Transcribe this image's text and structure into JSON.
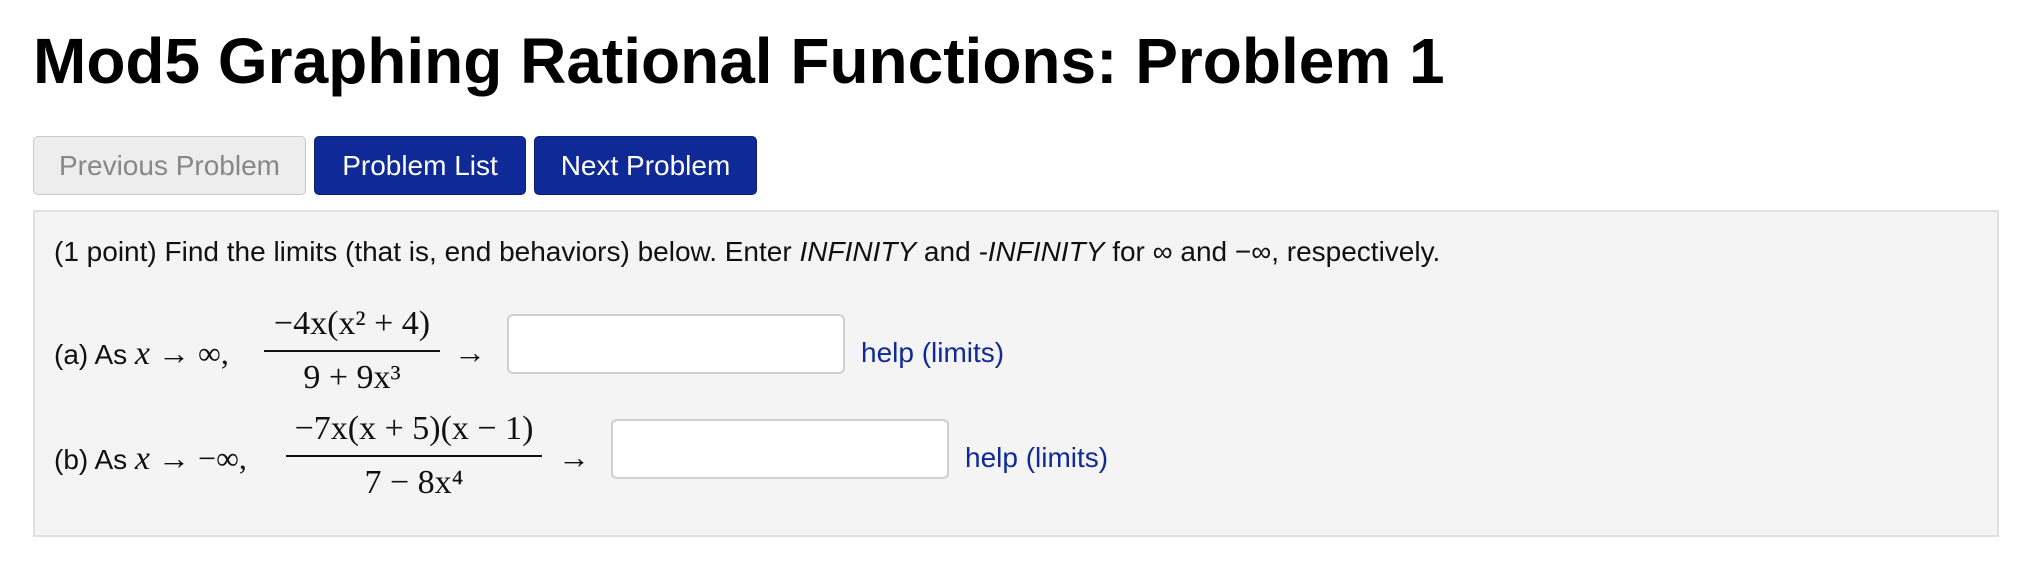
{
  "page": {
    "title": "Mod5 Graphing Rational Functions: Problem 1"
  },
  "nav": {
    "previous": "Previous Problem",
    "list": "Problem List",
    "next": "Next Problem"
  },
  "problem": {
    "points": "(1 point) Find the limits (that is, end behaviors) below. Enter ",
    "pos_inf_word": "INFINITY",
    "and_word": " and ",
    "neg_inf_word": "-INFINITY",
    "for_word": " for ∞ and −∞, respectively.",
    "parts": [
      {
        "label": "(a) As ",
        "var": "x",
        "approach": " → ∞,",
        "numerator": "−4x(x² + 4)",
        "denominator": "9 + 9x³",
        "arrow": "→",
        "answer": "",
        "help": "help (limits)"
      },
      {
        "label": "(b) As ",
        "var": "x",
        "approach": " → −∞,",
        "numerator": "−7x(x + 5)(x − 1)",
        "denominator": "7 − 8x⁴",
        "arrow": "→",
        "answer": "",
        "help": "help (limits)"
      }
    ]
  }
}
